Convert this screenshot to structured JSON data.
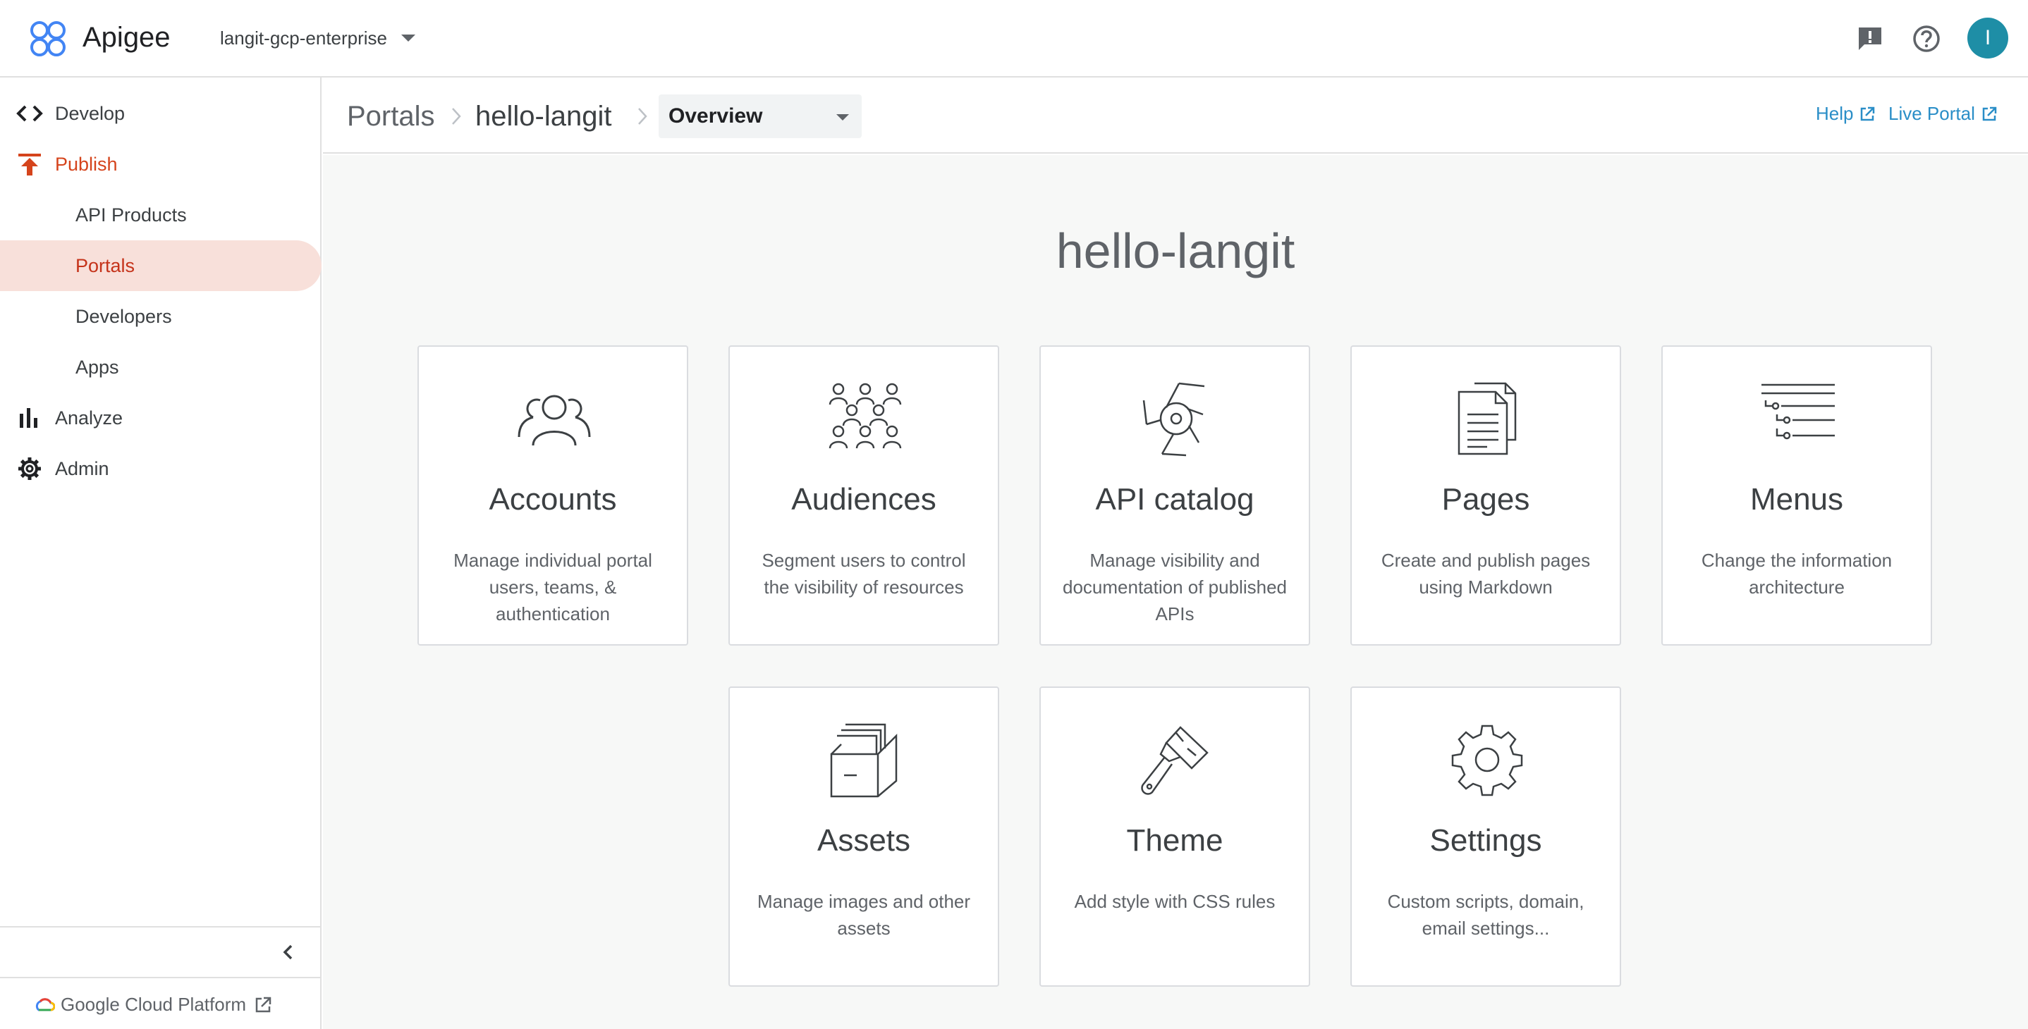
{
  "app": {
    "name": "Apigee",
    "org": "langit-gcp-enterprise",
    "avatar_letter": "I",
    "accent": "#1e8ea6"
  },
  "sidebar": {
    "items": [
      {
        "label": "Develop"
      },
      {
        "label": "Publish"
      },
      {
        "label": "API Products"
      },
      {
        "label": "Portals"
      },
      {
        "label": "Developers"
      },
      {
        "label": "Apps"
      },
      {
        "label": "Analyze"
      },
      {
        "label": "Admin"
      }
    ],
    "footer": "Google Cloud Platform",
    "active_color": "#c5331a"
  },
  "header": {
    "breadcrumb": [
      "Portals",
      "hello-langit"
    ],
    "view_select": "Overview",
    "help": "Help",
    "live_portal": "Live Portal"
  },
  "main": {
    "title": "hello-langit",
    "cards": [
      {
        "icon": "accounts-icon",
        "title": "Accounts",
        "desc": "Manage individual portal users, teams, & authentication"
      },
      {
        "icon": "audiences-icon",
        "title": "Audiences",
        "desc": "Segment users to control the visibility of resources"
      },
      {
        "icon": "api-catalog-icon",
        "title": "API catalog",
        "desc": "Manage visibility and documentation of published APIs"
      },
      {
        "icon": "pages-icon",
        "title": "Pages",
        "desc": "Create and publish pages using Markdown"
      },
      {
        "icon": "menus-icon",
        "title": "Menus",
        "desc": "Change the information architecture"
      },
      {
        "icon": "assets-icon",
        "title": "Assets",
        "desc": "Manage images and other assets"
      },
      {
        "icon": "theme-icon",
        "title": "Theme",
        "desc": "Add style with CSS rules"
      },
      {
        "icon": "settings-icon",
        "title": "Settings",
        "desc": "Custom scripts, domain, email settings..."
      }
    ]
  }
}
